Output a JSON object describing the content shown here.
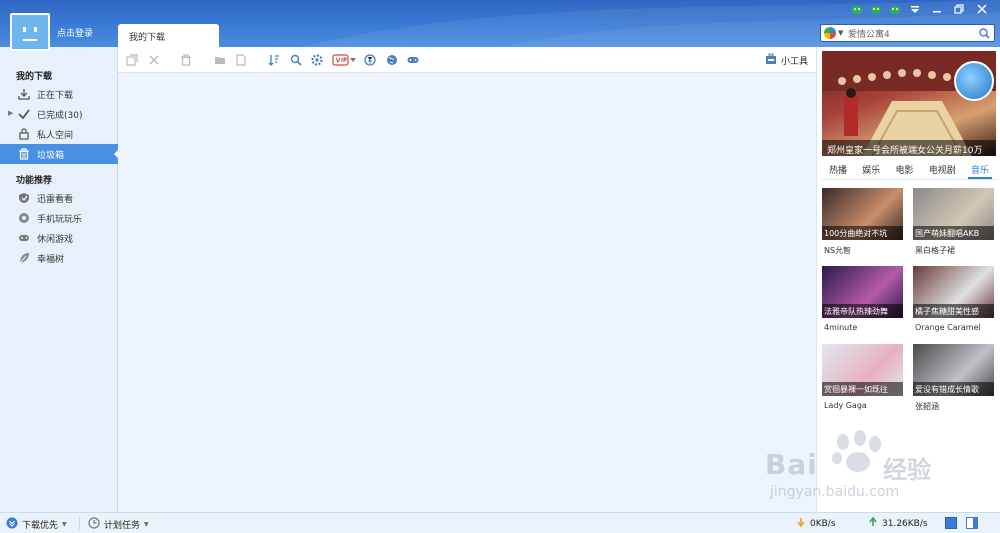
{
  "header": {
    "login_text": "点击登录",
    "tab_label": "我的下载",
    "search": {
      "value": "爱情公寓4"
    }
  },
  "sidebar": {
    "section1_title": "我的下载",
    "items1": [
      {
        "label": "正在下载",
        "icon": "download-icon"
      },
      {
        "label": "已完成(30)",
        "icon": "check-icon"
      },
      {
        "label": "私人空间",
        "icon": "lock-icon"
      },
      {
        "label": "垃圾箱",
        "icon": "trash-icon"
      }
    ],
    "section2_title": "功能推荐",
    "items2": [
      {
        "label": "迅雷看看",
        "icon": "shield-icon"
      },
      {
        "label": "手机玩玩乐",
        "icon": "gear-icon"
      },
      {
        "label": "休闲游戏",
        "icon": "gamepad-icon"
      },
      {
        "label": "幸福树",
        "icon": "leaf-icon"
      }
    ]
  },
  "toolbar": {
    "tools_label": "小工具"
  },
  "right_panel": {
    "banner_caption": "郑州皇家一号会所被端女公关月薪10万",
    "tabs": [
      "热播",
      "娱乐",
      "电影",
      "电视剧",
      "音乐"
    ],
    "cards": [
      {
        "caption": "100分曲绝对不坑",
        "name": "NS允智",
        "c1": "#3a2a2a",
        "c2": "#c98e6a"
      },
      {
        "caption": "国产萌妹翻唱AKB",
        "name": "黑白格子裙",
        "c1": "#8a8a8a",
        "c2": "#d2c7b5"
      },
      {
        "caption": "法雅帝队热辣劲舞",
        "name": "4minute",
        "c1": "#2a1a4a",
        "c2": "#b55aa8"
      },
      {
        "caption": "橘子焦糖甜美性感",
        "name": "Orange Caramel",
        "c1": "#6a3a3a",
        "c2": "#e0e0e0"
      },
      {
        "caption": "赏徊暴裸一如既往",
        "name": "Lady Gaga",
        "c1": "#dfe8f0",
        "c2": "#e8b0c0"
      },
      {
        "caption": "爱没有错成长情歌",
        "name": "张韶涵",
        "c1": "#4a4a4a",
        "c2": "#c0c0c8"
      }
    ]
  },
  "statusbar": {
    "priority_label": "下载优先",
    "plan_label": "计划任务",
    "down_speed": "0KB/s",
    "up_speed": "31.26KB/s"
  },
  "watermark": {
    "brand": "Bai",
    "brand2": "经验",
    "url": "jingyan.baidu.com"
  },
  "colors": {
    "accent": "#4a90e2",
    "titlebar": "#3a7bd5"
  }
}
